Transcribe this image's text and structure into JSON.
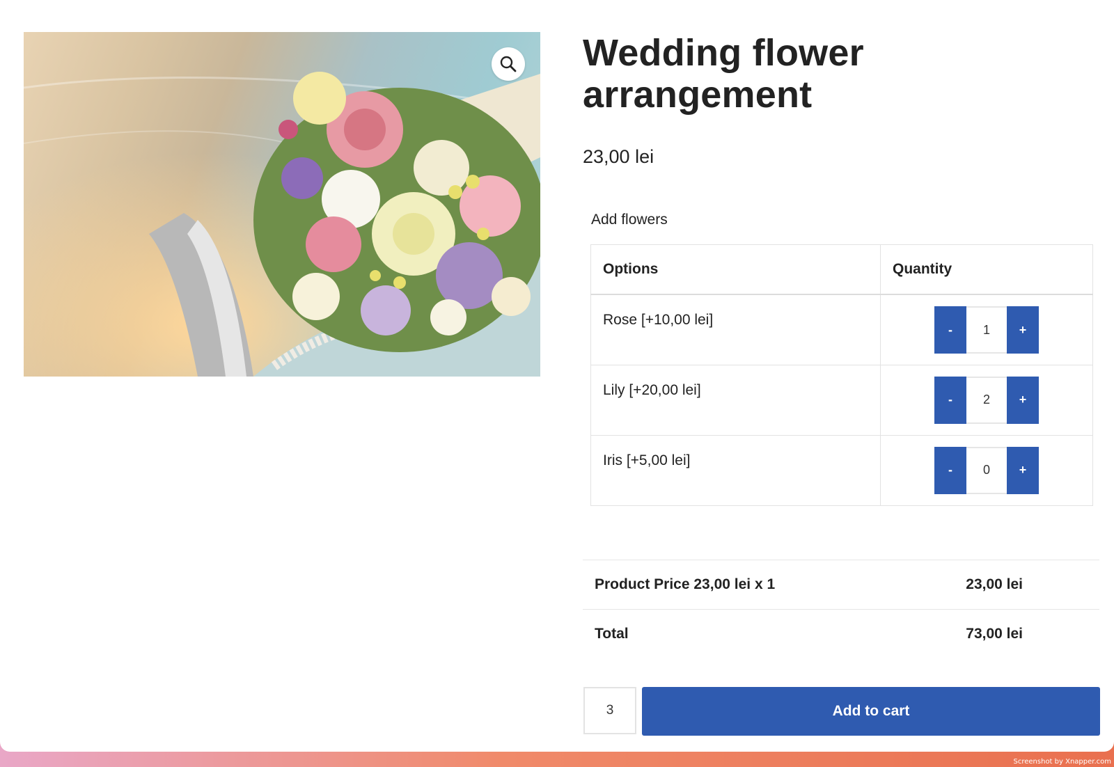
{
  "product": {
    "title": "Wedding flower arrangement",
    "price": "23,00 lei",
    "image_alt": "Bridal flower bouquet",
    "zoom_icon": "magnifier-icon"
  },
  "addons": {
    "label": "Add flowers",
    "headers": {
      "options": "Options",
      "quantity": "Quantity"
    },
    "rows": [
      {
        "option": "Rose [+10,00 lei]",
        "qty": "1",
        "minus": "-",
        "plus": "+"
      },
      {
        "option": "Lily [+20,00 lei]",
        "qty": "2",
        "minus": "-",
        "plus": "+"
      },
      {
        "option": "Iris [+5,00 lei]",
        "qty": "0",
        "minus": "-",
        "plus": "+"
      }
    ]
  },
  "totals": {
    "product_price_label": "Product Price 23,00 lei x 1",
    "product_price_value": "23,00 lei",
    "total_label": "Total",
    "total_value": "73,00 lei"
  },
  "cart": {
    "quantity": "3",
    "button_label": "Add to cart"
  },
  "footer": {
    "watermark": "Screenshot by Xnapper.com"
  },
  "colors": {
    "accent": "#2f5bb0",
    "text": "#222222",
    "border": "#e2e2e2"
  }
}
